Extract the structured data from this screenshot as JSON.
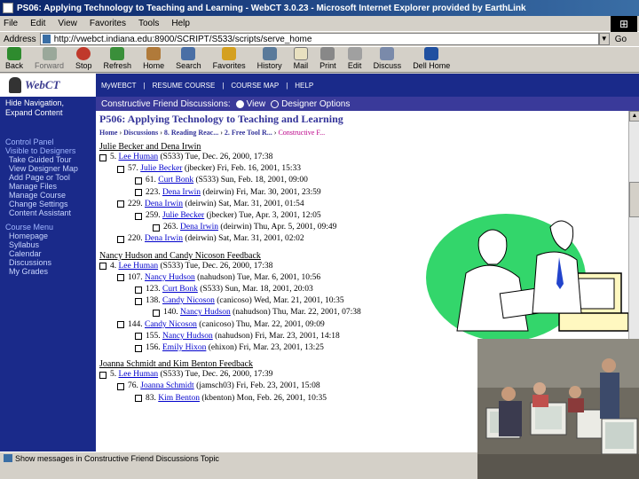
{
  "window": {
    "title": "PS06: Applying Technology to Teaching and Learning - WebCT 3.0.23 - Microsoft Internet Explorer provided by EarthLink"
  },
  "menu": [
    "File",
    "Edit",
    "View",
    "Favorites",
    "Tools",
    "Help"
  ],
  "address": {
    "label": "Address",
    "url": "http://vwebct.indiana.edu:8900/SCRIPT/S533/scripts/serve_home",
    "go": "Go"
  },
  "toolbar": [
    "Back",
    "Forward",
    "Stop",
    "Refresh",
    "Home",
    "Search",
    "Favorites",
    "History",
    "Mail",
    "Print",
    "Edit",
    "Discuss",
    "Dell Home"
  ],
  "webct": {
    "logo": "WebCT",
    "topnav": [
      "MyWEBCT",
      "RESUME COURSE",
      "COURSE MAP",
      "HELP"
    ],
    "sidebar": {
      "hide_nav": [
        "Hide Navigation,",
        "Expand Content"
      ],
      "control_panel_head": [
        "Control Panel",
        "Visible to Designers"
      ],
      "control_panel_items": [
        "Take Guided Tour",
        "View Designer Map",
        "Add Page or Tool",
        "Manage Files",
        "Manage Course",
        "Change Settings",
        "Content Assistant"
      ],
      "course_menu_head": "Course Menu",
      "course_menu_items": [
        "Homepage",
        "Syllabus",
        "Calendar",
        "Discussions",
        "My Grades"
      ]
    },
    "discstrip": {
      "title": "Constructive Friend Discussions:",
      "view": "View",
      "designer": "Designer Options"
    },
    "course_title": "P506: Applying Technology to Teaching and Learning",
    "breadcrumb": [
      "Home",
      "Discussions",
      "8. Reading Reac...",
      "2. Free Tool R...",
      "Constructive F..."
    ],
    "groups": [
      {
        "title": "Julie Becker and Dena Irwin",
        "messages": [
          {
            "indent": 0,
            "num": "5.",
            "author": "Lee Human",
            "rest": "(S533) Tue, Dec. 26, 2000, 17:38"
          },
          {
            "indent": 1,
            "num": "57.",
            "author": "Julie Becker",
            "rest": "(jbecker) Fri, Feb. 16, 2001, 15:33"
          },
          {
            "indent": 2,
            "num": "61.",
            "author": "Curt Bonk",
            "rest": "(S533) Sun, Feb. 18, 2001, 09:00"
          },
          {
            "indent": 2,
            "num": "223.",
            "author": "Dena Irwin",
            "rest": "(deirwin) Fri, Mar. 30, 2001, 23:59"
          },
          {
            "indent": 1,
            "num": "229.",
            "author": "Dena Irwin",
            "rest": "(deirwin) Sat, Mar. 31, 2001, 01:54"
          },
          {
            "indent": 2,
            "num": "259.",
            "author": "Julie Becker",
            "rest": "(jbecker) Tue, Apr. 3, 2001, 12:05"
          },
          {
            "indent": 3,
            "num": "263.",
            "author": "Dena Irwin",
            "rest": "(deirwin) Thu, Apr. 5, 2001, 09:49"
          },
          {
            "indent": 1,
            "num": "220.",
            "author": "Dena Irwin",
            "rest": "(deirwin) Sat, Mar. 31, 2001, 02:02"
          }
        ]
      },
      {
        "title": "Nancy Hudson and Candy Nicoson Feedback",
        "messages": [
          {
            "indent": 0,
            "num": "4.",
            "author": "Lee Human",
            "rest": "(S533) Tue, Dec. 26, 2000, 17:38"
          },
          {
            "indent": 1,
            "num": "107.",
            "author": "Nancy Hudson",
            "rest": "(nahudson) Tue, Mar. 6, 2001, 10:56"
          },
          {
            "indent": 2,
            "num": "123.",
            "author": "Curt Bonk",
            "rest": "(S533) Sun, Mar. 18, 2001, 20:03"
          },
          {
            "indent": 2,
            "num": "138.",
            "author": "Candy Nicoson",
            "rest": "(canicoso) Wed, Mar. 21, 2001, 10:35"
          },
          {
            "indent": 3,
            "num": "140.",
            "author": "Nancy Hudson",
            "rest": "(nahudson) Thu, Mar. 22, 2001, 07:38"
          },
          {
            "indent": 1,
            "num": "144.",
            "author": "Candy Nicoson",
            "rest": "(canicoso) Thu, Mar. 22, 2001, 09:09"
          },
          {
            "indent": 2,
            "num": "155.",
            "author": "Nancy Hudson",
            "rest": "(nahudson) Fri, Mar. 23, 2001, 14:18"
          },
          {
            "indent": 2,
            "num": "156.",
            "author": "Emily Hixon",
            "rest": "(ehixon) Fri, Mar. 23, 2001, 13:25"
          }
        ]
      },
      {
        "title": "Joanna Schmidt and Kim Benton Feedback",
        "messages": [
          {
            "indent": 0,
            "num": "5.",
            "author": "Lee Human",
            "rest": "(S533) Tue, Dec. 26, 2000, 17:39"
          },
          {
            "indent": 1,
            "num": "76.",
            "author": "Joanna Schmidt",
            "rest": "(jamsch03) Fri, Feb. 23, 2001, 15:08"
          },
          {
            "indent": 2,
            "num": "83.",
            "author": "Kim Benton",
            "rest": "(kbenton) Mon, Feb. 26, 2001, 10:35"
          }
        ]
      }
    ]
  },
  "status": "Show messages in Constructive Friend Discussions Topic",
  "icons": {
    "back": "back-arrow-icon",
    "forward": "forward-arrow-icon",
    "stop": "stop-icon",
    "refresh": "refresh-icon",
    "home": "home-icon",
    "search": "search-icon",
    "favorites": "favorites-icon",
    "history": "history-icon",
    "mail": "mail-icon",
    "print": "print-icon",
    "edit": "edit-icon",
    "discuss": "discuss-icon",
    "dellhome": "dell-home-icon"
  }
}
